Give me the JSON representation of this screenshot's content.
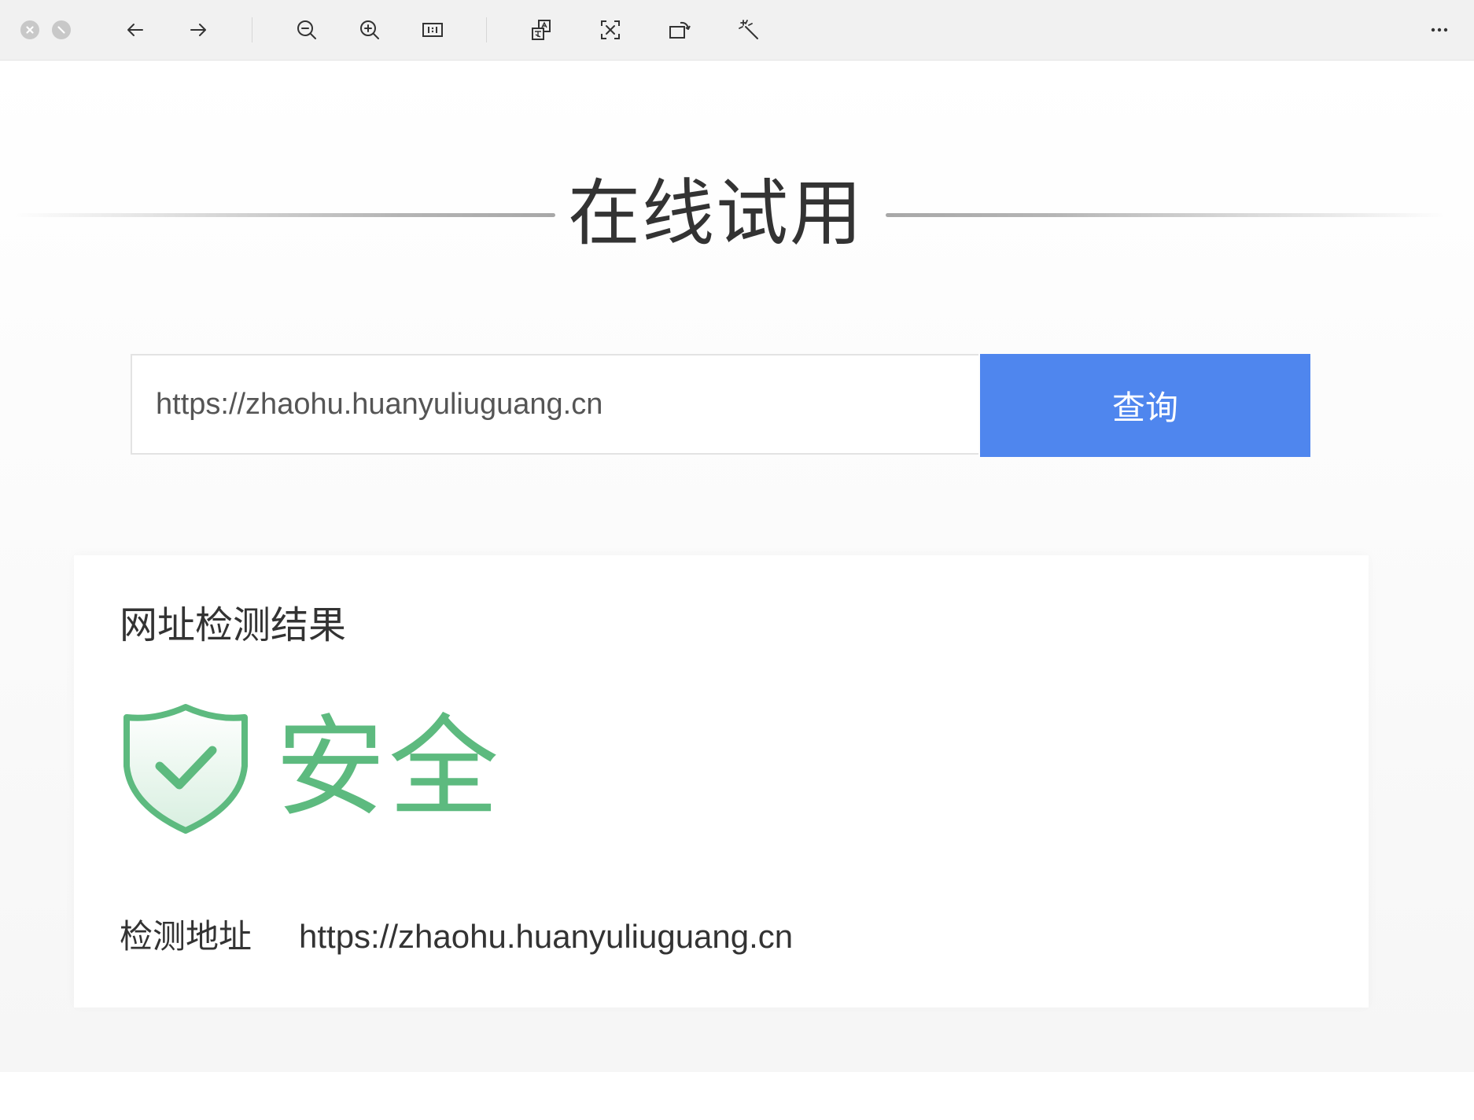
{
  "viewer": {
    "toolbar_icons": [
      "close-icon",
      "minimize-icon",
      "back-arrow-icon",
      "forward-arrow-icon",
      "zoom-out-icon",
      "zoom-in-icon",
      "actual-size-icon",
      "translate-icon",
      "text-recognition-icon",
      "rotate-icon",
      "magic-wand-icon",
      "more-icon"
    ]
  },
  "page": {
    "title": "在线试用",
    "search": {
      "value": "https://zhaohu.huanyuliuguang.cn",
      "button_label": "查询"
    },
    "result": {
      "title": "网址检测结果",
      "status": "安全",
      "address_label": "检测地址",
      "address_value": "https://zhaohu.huanyuliuguang.cn"
    }
  },
  "colors": {
    "accent_blue": "#4f86ee",
    "safe_green": "#5dba7f",
    "text": "#333333"
  }
}
